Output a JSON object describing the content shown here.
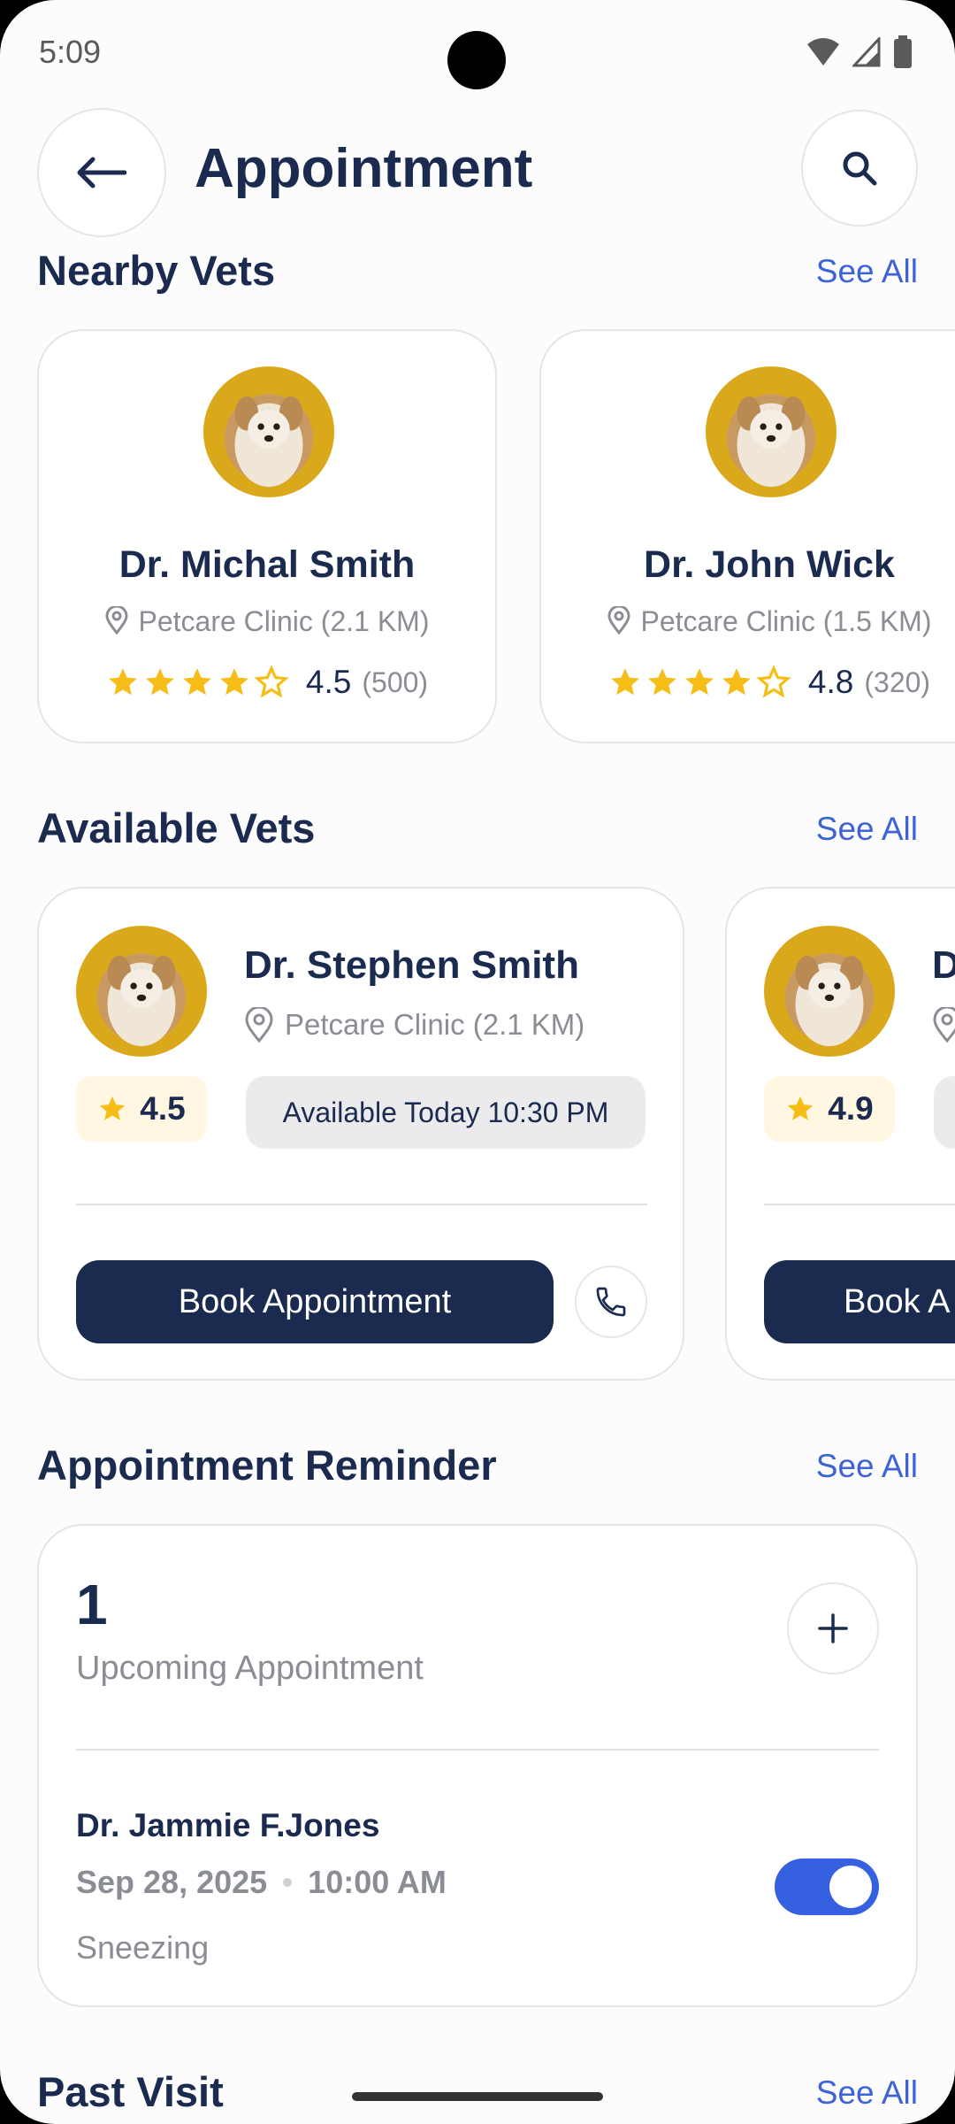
{
  "status_bar": {
    "time": "5:09"
  },
  "header": {
    "title": "Appointment"
  },
  "sections": {
    "nearby": {
      "title": "Nearby Vets",
      "see_all": "See All"
    },
    "available": {
      "title": "Available Vets",
      "see_all": "See All"
    },
    "reminder": {
      "title": "Appointment Reminder",
      "see_all": "See All"
    },
    "past": {
      "title": "Past Visit",
      "see_all": "See All"
    }
  },
  "nearby_vets": [
    {
      "name": "Dr. Michal Smith",
      "clinic": "Petcare Clinic (2.1 KM)",
      "rating": "4.5",
      "reviews": "(500)",
      "stars_filled": 4
    },
    {
      "name": "Dr. John Wick",
      "clinic": "Petcare Clinic (1.5 KM)",
      "rating": "4.8",
      "reviews": "(320)",
      "stars_filled": 4
    }
  ],
  "available_vets": [
    {
      "name": "Dr. Stephen Smith",
      "clinic": "Petcare Clinic (2.1 KM)",
      "rating": "4.5",
      "availability": "Available Today 10:30 PM",
      "book_label": "Book Appointment"
    },
    {
      "name": "D",
      "rating": "4.9",
      "book_label": "Book A"
    }
  ],
  "reminder": {
    "count": "1",
    "label": "Upcoming Appointment",
    "doctor": "Dr. Jammie F.Jones",
    "date": "Sep 28, 2025",
    "time": "10:00 AM",
    "note": "Sneezing",
    "enabled": true
  },
  "colors": {
    "primary": "#1b2a4f",
    "accent": "#3d63d6",
    "star": "#f5bd16",
    "toggle": "#3561e0"
  }
}
